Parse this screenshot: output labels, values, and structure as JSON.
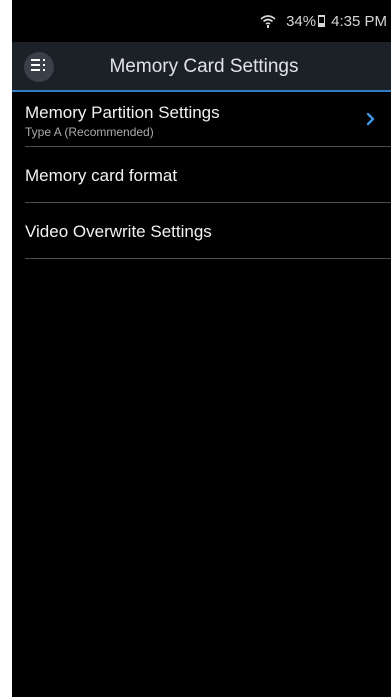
{
  "status_bar": {
    "wifi_icon": "wifi-icon",
    "battery_percent": "34%",
    "battery_level": 0.34,
    "time": "4:35 PM"
  },
  "app_bar": {
    "menu_icon": "menu-icon",
    "title": "Memory Card Settings"
  },
  "colors": {
    "background": "#000000",
    "app_bar": "#1c2027",
    "accent": "#2f7ec4",
    "divider": "#4a4d52"
  },
  "settings": [
    {
      "title": "Memory Partition Settings",
      "subtitle": "Type A (Recommended)",
      "has_chevron": true,
      "chevron_icon": "chevron-right-icon"
    },
    {
      "title": "Memory card format",
      "has_chevron": false
    },
    {
      "title": "Video Overwrite Settings",
      "has_chevron": false
    }
  ]
}
